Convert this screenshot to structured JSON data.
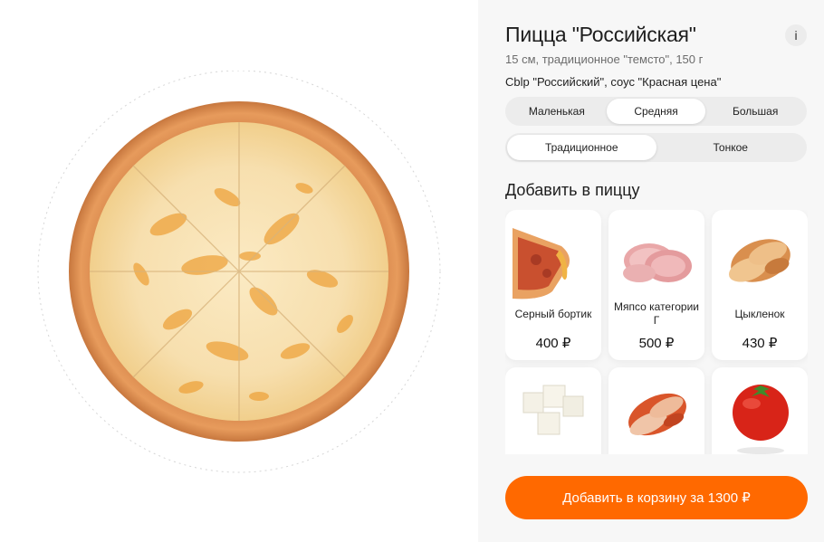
{
  "product": {
    "title": "Пицца \"Российская\"",
    "info_icon": "i",
    "subtitle": "15 см, традиционное \"темсто\", 150 г",
    "ingredients": "Cblp \"Российский\", соус \"Красная цена\""
  },
  "size_options": [
    {
      "label": "Маленькая",
      "selected": false
    },
    {
      "label": "Средняя",
      "selected": true
    },
    {
      "label": "Большая",
      "selected": false
    }
  ],
  "dough_options": [
    {
      "label": "Традиционное",
      "selected": true
    },
    {
      "label": "Тонкое",
      "selected": false
    }
  ],
  "toppings_title": "Добавить в пиццу",
  "toppings": [
    {
      "name": "Серный бортик",
      "price": "400 ₽",
      "icon": "cheese-crust-image"
    },
    {
      "name": "Мяпсо категории Г",
      "price": "500 ₽",
      "icon": "ham-image"
    },
    {
      "name": "Цыкленок",
      "price": "430 ₽",
      "icon": "chicken-image"
    },
    {
      "name": "",
      "price": "",
      "icon": "cheese-cubes-image"
    },
    {
      "name": "",
      "price": "",
      "icon": "spicy-chicken-image"
    },
    {
      "name": "",
      "price": "",
      "icon": "tomato-image"
    }
  ],
  "cart_button": "Добавить в корзину за 1300 ₽",
  "colors": {
    "accent": "#ff6900",
    "panel_bg": "#f7f7f7",
    "card_bg": "#ffffff"
  }
}
